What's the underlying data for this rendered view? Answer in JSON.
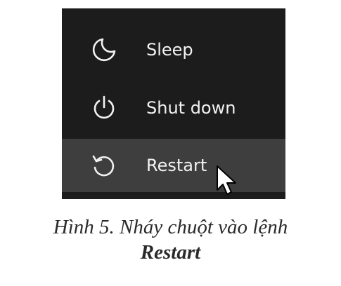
{
  "power_menu": {
    "items": [
      {
        "label": "Sleep",
        "icon": "moon-icon"
      },
      {
        "label": "Shut down",
        "icon": "power-icon"
      },
      {
        "label": "Restart",
        "icon": "restart-icon",
        "highlighted": true
      }
    ],
    "colors": {
      "background": "#1c1c1c",
      "highlight": "#3e3e3e",
      "text": "#f2f2f2"
    }
  },
  "caption": {
    "line1": "Hình 5. Nháy chuột vào lệnh",
    "line2": "Restart"
  }
}
